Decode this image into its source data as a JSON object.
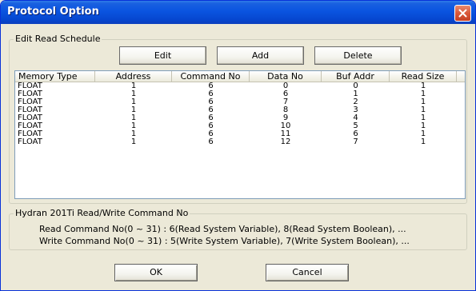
{
  "window": {
    "title": "Protocol Option"
  },
  "edit_group": {
    "legend": "Edit Read Schedule",
    "edit_label": "Edit",
    "add_label": "Add",
    "delete_label": "Delete"
  },
  "table": {
    "columns": [
      "Memory Type",
      "Address",
      "Command No",
      "Data No",
      "Buf Addr",
      "Read Size"
    ],
    "rows": [
      [
        "FLOAT",
        "1",
        "6",
        "0",
        "0",
        "1"
      ],
      [
        "FLOAT",
        "1",
        "6",
        "6",
        "1",
        "1"
      ],
      [
        "FLOAT",
        "1",
        "6",
        "7",
        "2",
        "1"
      ],
      [
        "FLOAT",
        "1",
        "6",
        "8",
        "3",
        "1"
      ],
      [
        "FLOAT",
        "1",
        "6",
        "9",
        "4",
        "1"
      ],
      [
        "FLOAT",
        "1",
        "6",
        "10",
        "5",
        "1"
      ],
      [
        "FLOAT",
        "1",
        "6",
        "11",
        "6",
        "1"
      ],
      [
        "FLOAT",
        "1",
        "6",
        "12",
        "7",
        "1"
      ]
    ]
  },
  "info_group": {
    "legend": "Hydran 201Ti Read/Write Command No",
    "read_line": "Read Command No(0 ~ 31) : 6(Read System Variable), 8(Read System Boolean),  ...",
    "write_line": "Write Command No(0 ~ 31) : 5(Write System Variable), 7(Write System Boolean),  ..."
  },
  "footer": {
    "ok_label": "OK",
    "cancel_label": "Cancel"
  },
  "icons": {
    "close": "close-icon"
  },
  "colors": {
    "titlebar": "#0a54e0",
    "window_bg": "#ece9d8",
    "list_border": "#7f9db9"
  }
}
